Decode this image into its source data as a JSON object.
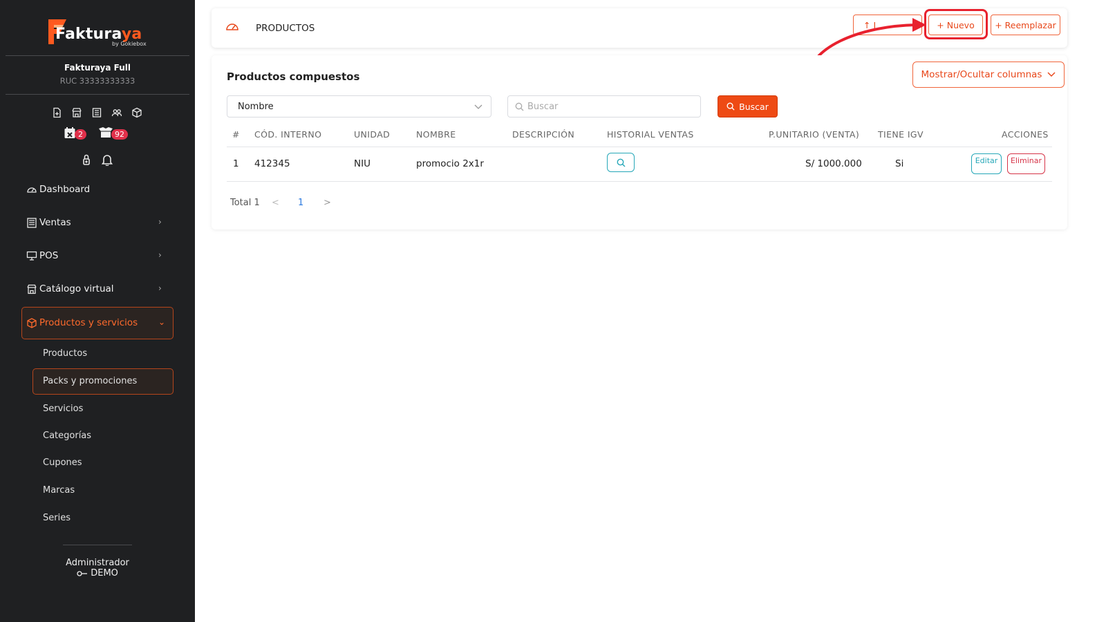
{
  "brand": {
    "name_main": "Fakturaya",
    "name_prefix": "Fakturaya",
    "by": "by Gokiebox",
    "accent": "#ff5a1f"
  },
  "company": {
    "name": "Fakturaya Full",
    "ruc": "RUC 33333333333"
  },
  "badges": {
    "calendar_count": "2",
    "boxes_count": "92"
  },
  "sidebar": {
    "items": [
      {
        "label": "Dashboard",
        "icon": "gauge-icon"
      },
      {
        "label": "Ventas",
        "icon": "ledger-icon"
      },
      {
        "label": "POS",
        "icon": "monitor-icon"
      },
      {
        "label": "Catálogo virtual",
        "icon": "store-icon"
      },
      {
        "label": "Productos y servicios",
        "icon": "box-icon"
      }
    ],
    "subitems": [
      "Productos",
      "Packs y promociones",
      "Servicios",
      "Categorías",
      "Cupones",
      "Marcas",
      "Series"
    ]
  },
  "user": {
    "role": "Administrador",
    "name": "DEMO"
  },
  "header": {
    "title": "PRODUCTOS",
    "btn_import": "↑ I",
    "btn_new": "+ Nuevo",
    "btn_replace": "+ Reemplazar"
  },
  "card": {
    "title": "Productos compuestos",
    "columns_btn": "Mostrar/Ocultar columnas"
  },
  "filter": {
    "select_value": "Nombre",
    "search_placeholder": "Buscar",
    "search_btn": "Buscar"
  },
  "table": {
    "headers": [
      "#",
      "CÓD. INTERNO",
      "UNIDAD",
      "NOMBRE",
      "DESCRIPCIÓN",
      "HISTORIAL VENTAS",
      "P.UNITARIO (VENTA)",
      "TIENE IGV",
      "ACCIONES"
    ],
    "rows": [
      {
        "num": "1",
        "code": "412345",
        "unit": "NIU",
        "name": "promocio 2x1r",
        "desc": "",
        "price": "S/ 1000.000",
        "igv": "Si",
        "edit": "Editar",
        "delete": "Eliminar"
      }
    ]
  },
  "pagination": {
    "total": "Total 1",
    "page": "1",
    "prev": "<",
    "next": ">"
  }
}
